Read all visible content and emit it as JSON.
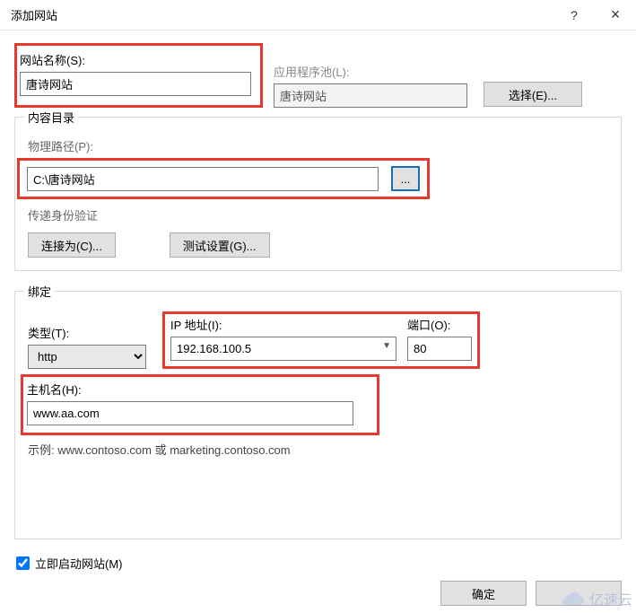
{
  "window": {
    "title": "添加网站",
    "help": "?",
    "close": "×"
  },
  "site": {
    "name_label": "网站名称(S):",
    "name_value": "唐诗网站",
    "pool_label": "应用程序池(L):",
    "pool_value": "唐诗网站",
    "select_btn": "选择(E)..."
  },
  "content_dir": {
    "legend": "内容目录",
    "path_label": "物理路径(P):",
    "path_value": "C:\\唐诗网站",
    "browse": "...",
    "auth_label": "传递身份验证",
    "connect_as": "连接为(C)...",
    "test_settings": "测试设置(G)..."
  },
  "binding": {
    "legend": "绑定",
    "type_label": "类型(T):",
    "type_value": "http",
    "ip_label": "IP 地址(I):",
    "ip_value": "192.168.100.5",
    "port_label": "端口(O):",
    "port_value": "80",
    "host_label": "主机名(H):",
    "host_value": "www.aa.com",
    "example": "示例: www.contoso.com 或 marketing.contoso.com"
  },
  "start_now": "立即启动网站(M)",
  "footer": {
    "ok": "确定"
  },
  "watermark": "亿速云"
}
